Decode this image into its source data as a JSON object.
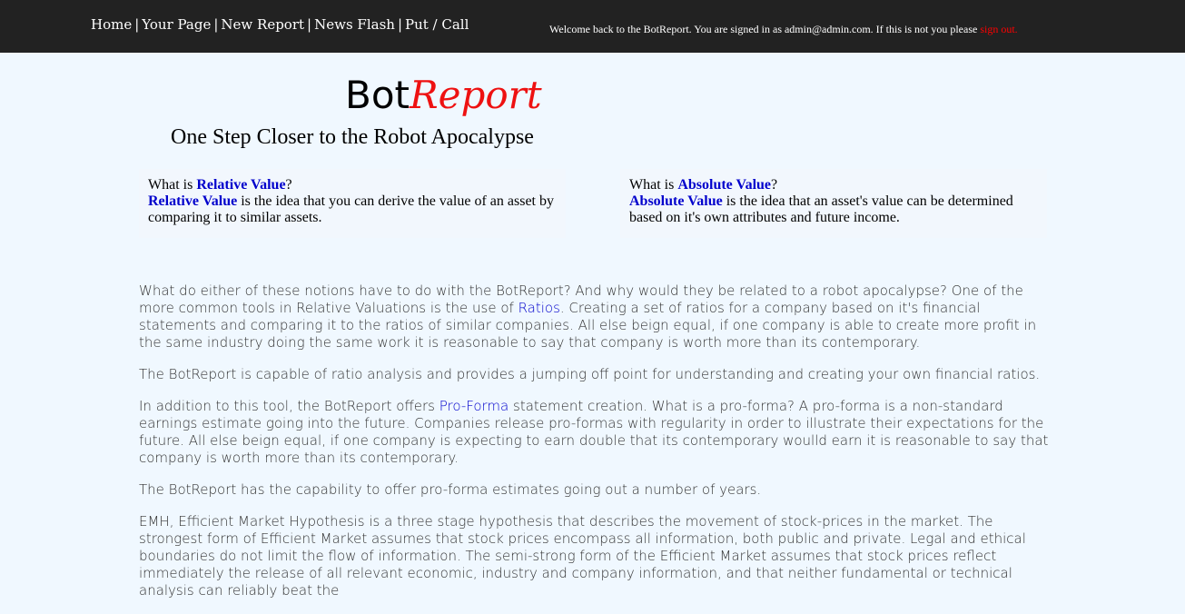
{
  "nav": {
    "items": [
      "Home",
      "Your Page",
      "New Report",
      "News Flash",
      "Put / Call"
    ],
    "separator": "|"
  },
  "welcome": {
    "text": "Welcome back to the BotReport. You are signed in as admin@admin.com. If this is not you please ",
    "signout_label": "sign out."
  },
  "logo": {
    "part1": "Bot",
    "part2": "Report"
  },
  "tagline": "One Step Closer to the Robot Apocalypse",
  "boxes": {
    "relative": {
      "q_prefix": "What is ",
      "term": "Relative Value",
      "q_suffix": "?",
      "body": " is the idea that you can derive the value of an asset by comparing it to similar assets."
    },
    "absolute": {
      "q_prefix": "What is ",
      "term": "Absolute Value",
      "q_suffix": "?",
      "body": " is the idea that an asset's value can be determined based on it's own attributes and future income."
    }
  },
  "content": {
    "p1_a": "What do either of these notions have to do with the BotReport? And why would they be related to a robot apocalypse? One of the more common tools in Relative Valuations is the use of ",
    "p1_link": "Ratios",
    "p1_b": ". Creating a set of ratios for a company based on it's financial statements and comparing it to the ratios of similar companies. All else beign equal, if one company is able to create more profit in the same industry doing the same work it is reasonable to say that company is worth more than its contemporary.",
    "p2": "The BotReport is capable of ratio analysis and provides a jumping off point for understanding and creating your own financial ratios.",
    "p3_a": "In addition to this tool, the BotReport offers ",
    "p3_link": "Pro-Forma",
    "p3_b": " statement creation. What is a pro-forma? A pro-forma is a non-standard earnings estimate going into the future. Companies release pro-formas with regularity in order to illustrate their expectations for the future. All else beign equal, if one company is expecting to earn double that its contemporary woulld earn it is reasonable to say that company is worth more than its contemporary.",
    "p4": "The BotReport has the capability to offer pro-forma estimates going out a number of years.",
    "p5": "EMH, Efficient Market Hypothesis is a three stage hypothesis that describes the movement of stock-prices in the market. The strongest form of Efficient Market assumes that stock prices encompass all information, both public and private. Legal and ethical boundaries do not limit the flow of information. The semi-strong form of the Efficient Market assumes that stock prices reflect immediately the release of all relevant economic, industry and company information, and that neither fundamental or technical analysis can reliably beat the"
  },
  "colors": {
    "topbar": "#222222",
    "page_bg": "#f0f8ff",
    "link_blue": "#0000cc",
    "signout_red": "#ff0000",
    "logo_red": "#ee1111"
  }
}
